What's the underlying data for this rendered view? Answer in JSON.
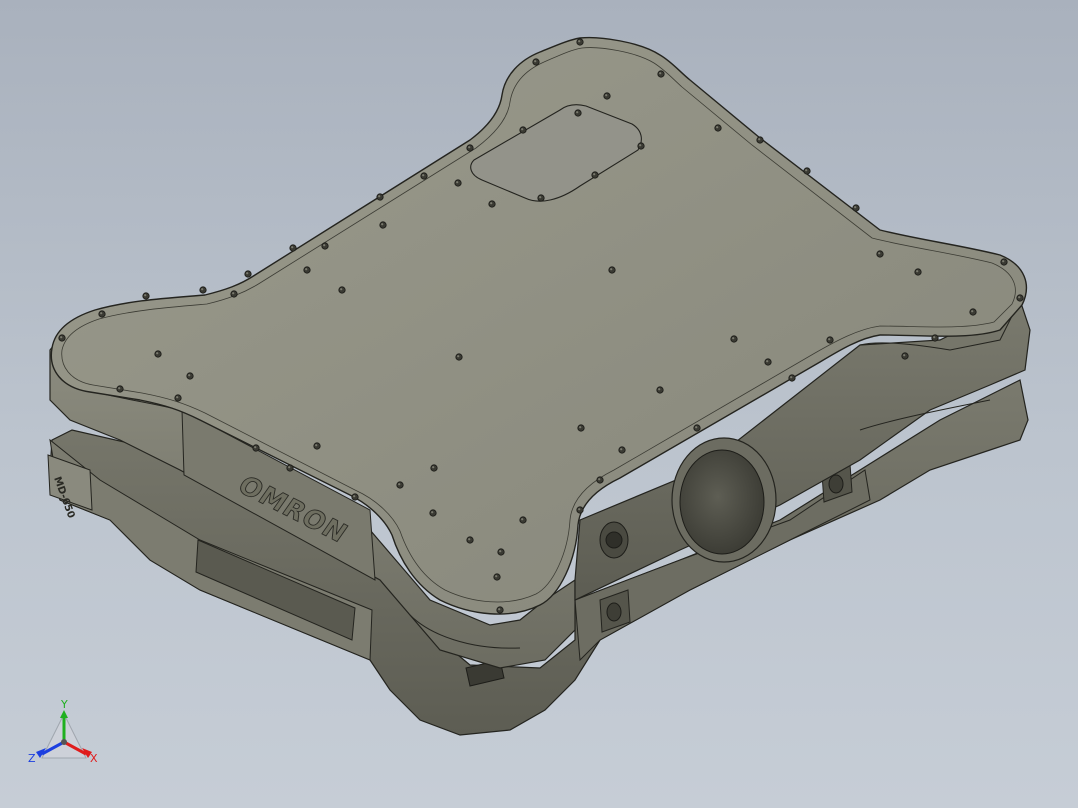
{
  "scene": {
    "background_top": "#a9b1bd",
    "background_bottom": "#c6cdd6",
    "body_color": "#8a8a7c",
    "edge_color": "#24241f"
  },
  "labels": {
    "brand": "OMRON",
    "model": "MD-650"
  },
  "triad": {
    "x_label": "X",
    "y_label": "Y",
    "z_label": "Z",
    "x_color": "#e01c1c",
    "y_color": "#1fb01f",
    "z_color": "#1c3fe0"
  }
}
